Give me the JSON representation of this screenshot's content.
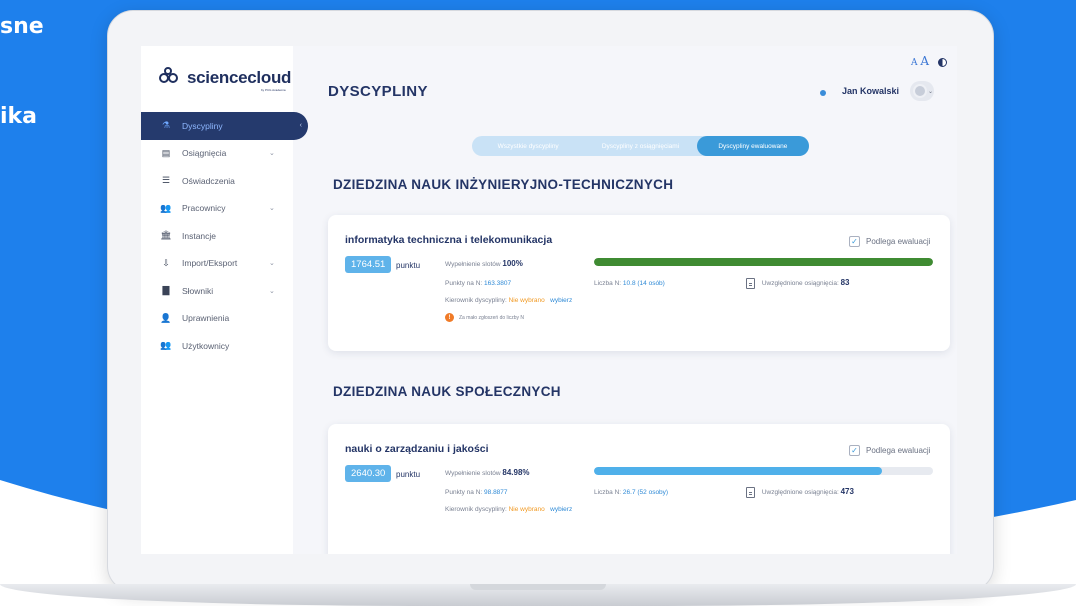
{
  "background_text": {
    "line1": "sne",
    "line2": "ika"
  },
  "colors": {
    "accent": "#3a9ad9",
    "sidebar_active": "#253a6d",
    "progress_green": "#3f8b32",
    "progress_blue": "#4fb0ea",
    "warning": "#f07b28"
  },
  "logo": {
    "name": "sciencecloud",
    "sub": "by PCG Academia"
  },
  "sidebar": {
    "items": [
      {
        "label": "Dyscypliny",
        "icon": "flask-icon",
        "active": true
      },
      {
        "label": "Osiągnięcia",
        "icon": "table-icon",
        "chevron": true
      },
      {
        "label": "Oświadczenia",
        "icon": "list-icon"
      },
      {
        "label": "Pracownicy",
        "icon": "users-icon",
        "chevron": true
      },
      {
        "label": "Instancje",
        "icon": "building-icon"
      },
      {
        "label": "Import/Eksport",
        "icon": "import-icon",
        "chevron": true
      },
      {
        "label": "Słowniki",
        "icon": "book-icon",
        "chevron": true
      },
      {
        "label": "Uprawnienia",
        "icon": "user-key-icon"
      },
      {
        "label": "Użytkownicy",
        "icon": "users-icon"
      }
    ]
  },
  "header": {
    "title": "DYSCYPLINY",
    "font_small": "A",
    "font_large": "A",
    "user_name": "Jan Kowalski"
  },
  "tabs": [
    {
      "label": "Wszystkie dyscypliny",
      "active": false
    },
    {
      "label": "Dyscypliny z osiągnięciami",
      "active": false
    },
    {
      "label": "Dyscypliny ewaluowane",
      "active": true
    }
  ],
  "sections": [
    {
      "title": "DZIEDZINA NAUK INŻYNIERYJNO-TECHNICZNYCH",
      "card": {
        "title": "informatyka techniczna i telekomunikacja",
        "evaluation_label": "Podlega ewaluacji",
        "points": "1764.51",
        "points_unit": "punktu",
        "slots_label": "Wypełnienie slotów",
        "slots_value": "100%",
        "progress": 1.0,
        "points_n_label": "Punkty na N:",
        "points_n_value": "163.3807",
        "count_n_label": "Liczba N:",
        "count_n_value": "10.8 (14 osób)",
        "achievements_label": "Uwzględnione osiągnięcia:",
        "achievements_value": "83",
        "manager_label": "Kierownik dyscypliny:",
        "manager_value": "Nie wybrano",
        "manager_link": "wybierz",
        "warning": "Za mało zgłoszeń do liczby N"
      }
    },
    {
      "title": "DZIEDZINA NAUK SPOŁECZNYCH",
      "card": {
        "title": "nauki o zarządzaniu i jakości",
        "evaluation_label": "Podlega ewaluacji",
        "points": "2640.30",
        "points_unit": "punktu",
        "slots_label": "Wypełnienie slotów",
        "slots_value": "84.98%",
        "progress": 0.8498,
        "points_n_label": "Punkty na N:",
        "points_n_value": "98.8877",
        "count_n_label": "Liczba N:",
        "count_n_value": "26.7 (52 osoby)",
        "achievements_label": "Uwzględnione osiągnięcia:",
        "achievements_value": "473",
        "manager_label": "Kierownik dyscypliny:",
        "manager_value": "Nie wybrano",
        "manager_link": "wybierz"
      }
    }
  ]
}
